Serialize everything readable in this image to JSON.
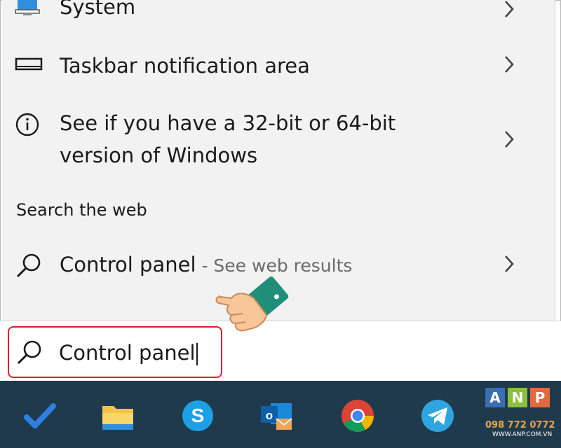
{
  "results": [
    {
      "label": "System",
      "icon": "monitor-icon"
    },
    {
      "label": "Taskbar notification area",
      "icon": "taskbar-icon"
    },
    {
      "label_line1": "See if you have a 32-bit or 64-bit",
      "label_line2": "version of Windows",
      "icon": "info-icon"
    }
  ],
  "web_section": {
    "heading": "Search the web",
    "item_query": "Control panel",
    "item_suffix": " - See web results",
    "icon": "search-icon"
  },
  "search": {
    "value": "Control panel",
    "icon": "search-icon"
  },
  "taskbar": {
    "icons": [
      "todo-check-icon",
      "file-explorer-icon",
      "skype-icon",
      "outlook-icon",
      "chrome-icon",
      "telegram-icon"
    ]
  },
  "watermark": {
    "letters": [
      "A",
      "N",
      "P"
    ],
    "phone": "098 772 0772",
    "url": "WWW.ANP.COM.VN"
  },
  "colors": {
    "panel_bg": "#f2f2f2",
    "highlight_border": "#e01e2c",
    "taskbar_bg": "#1f3a4d",
    "muted_text": "#6b6b6b"
  }
}
